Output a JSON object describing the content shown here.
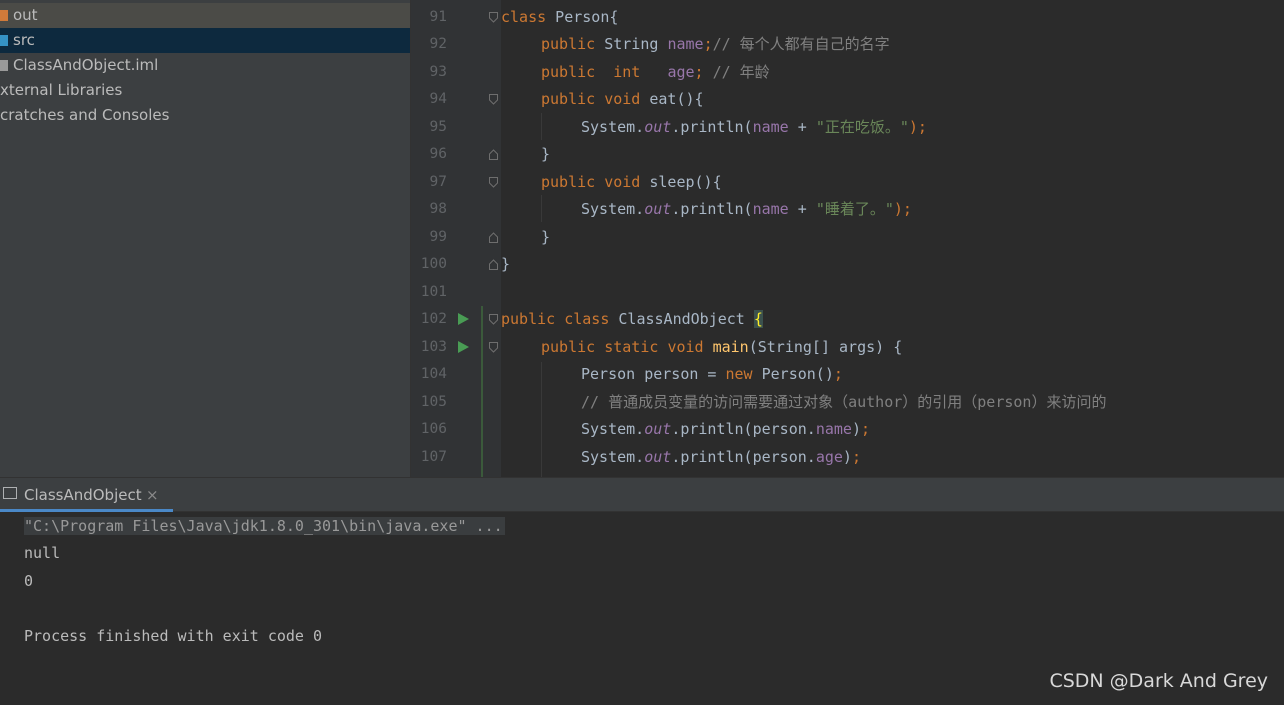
{
  "project_tree": [
    {
      "label": "out",
      "icon": "folder-icon",
      "color": "#d07a3a"
    },
    {
      "label": "src",
      "icon": "folder-icon",
      "color": "#3592c4"
    },
    {
      "label": "ClassAndObject.iml",
      "icon": "file-icon"
    },
    {
      "label": "xternal Libraries"
    },
    {
      "label": "cratches and Consoles"
    }
  ],
  "editor": {
    "lines": [
      {
        "num": "91"
      },
      {
        "num": "92"
      },
      {
        "num": "93"
      },
      {
        "num": "94"
      },
      {
        "num": "95"
      },
      {
        "num": "96"
      },
      {
        "num": "97"
      },
      {
        "num": "98"
      },
      {
        "num": "99"
      },
      {
        "num": "100"
      },
      {
        "num": "101"
      },
      {
        "num": "102"
      },
      {
        "num": "103"
      },
      {
        "num": "104"
      },
      {
        "num": "105"
      },
      {
        "num": "106"
      },
      {
        "num": "107"
      }
    ],
    "tokens": {
      "l91": [
        "class",
        " Person{"
      ],
      "l92": [
        "public",
        " String ",
        "name",
        ";",
        "// 每个人都有自己的名字"
      ],
      "l93": [
        "public",
        "  ",
        "int",
        "   ",
        "age",
        ";",
        " // 年龄"
      ],
      "l94": [
        "public",
        " ",
        "void",
        " eat(){"
      ],
      "l95": [
        "System.",
        "out",
        ".println(",
        "name",
        " + ",
        "\"正在吃饭。\"",
        ");"
      ],
      "l96": [
        "}"
      ],
      "l97": [
        "public",
        " ",
        "void",
        " sleep(){"
      ],
      "l98": [
        "System.",
        "out",
        ".println(",
        "name",
        " + ",
        "\"睡着了。\"",
        ");"
      ],
      "l99": [
        "}"
      ],
      "l100": [
        "}"
      ],
      "l102": [
        "public",
        " ",
        "class",
        " ClassAndObject ",
        "{"
      ],
      "l103": [
        "public",
        " ",
        "static",
        " ",
        "void",
        " ",
        "main",
        "(String[] args) {"
      ],
      "l104": [
        "Person person = ",
        "new",
        " Person()",
        ";"
      ],
      "l105": [
        "// 普通成员变量的访问需要通过对象（author）的引用（person）来访问的"
      ],
      "l106": [
        "System.",
        "out",
        ".println(person.",
        "name",
        ")",
        ";"
      ],
      "l107": [
        "System.",
        "out",
        ".println(person.",
        "age",
        ")",
        ";"
      ]
    }
  },
  "run_tab": {
    "label": "ClassAndObject",
    "close": "×"
  },
  "console": {
    "lines": [
      "\"C:\\Program Files\\Java\\jdk1.8.0_301\\bin\\java.exe\" ...",
      "null",
      "0",
      "",
      "Process finished with exit code 0"
    ]
  },
  "watermark": "CSDN @Dark And Grey",
  "colors": {
    "keyword": "#cc7832",
    "field": "#9876aa",
    "string": "#6a8759",
    "comment": "#808080",
    "method": "#ffc66d"
  }
}
